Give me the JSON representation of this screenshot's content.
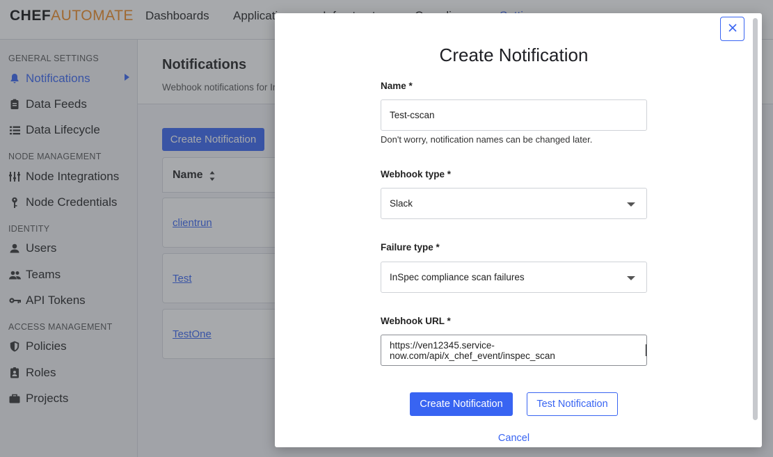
{
  "app": {
    "logo_primary": "CHEF",
    "logo_secondary": "AUTOMATE"
  },
  "topnav": {
    "items": [
      "Dashboards",
      "Applications",
      "Infrastructure",
      "Compliance",
      "Settings"
    ]
  },
  "sidebar": {
    "sections": [
      {
        "title": "GENERAL SETTINGS",
        "items": [
          {
            "label": "Notifications",
            "icon": "bell-icon",
            "active": true
          },
          {
            "label": "Data Feeds",
            "icon": "clipboard-icon"
          },
          {
            "label": "Data Lifecycle",
            "icon": "list-icon"
          }
        ]
      },
      {
        "title": "NODE MANAGEMENT",
        "items": [
          {
            "label": "Node Integrations",
            "icon": "sliders-icon"
          },
          {
            "label": "Node Credentials",
            "icon": "key-icon"
          }
        ]
      },
      {
        "title": "IDENTITY",
        "items": [
          {
            "label": "Users",
            "icon": "user-icon"
          },
          {
            "label": "Teams",
            "icon": "team-icon"
          },
          {
            "label": "API Tokens",
            "icon": "token-key-icon"
          }
        ]
      },
      {
        "title": "ACCESS MANAGEMENT",
        "items": [
          {
            "label": "Policies",
            "icon": "shield-icon"
          },
          {
            "label": "Roles",
            "icon": "badge-icon"
          },
          {
            "label": "Projects",
            "icon": "briefcase-icon"
          }
        ]
      }
    ]
  },
  "page": {
    "title": "Notifications",
    "subtitle": "Webhook notifications for Infrastructure and Compliance",
    "create_button": "Create Notification",
    "table": {
      "header": "Name",
      "rows": [
        "clientrun",
        "Test",
        "TestOne"
      ]
    }
  },
  "modal": {
    "title": "Create Notification",
    "name": {
      "label": "Name *",
      "value": "Test-cscan",
      "hint": "Don't worry, notification names can be changed later."
    },
    "webhook_type": {
      "label": "Webhook type *",
      "value": "Slack"
    },
    "failure_type": {
      "label": "Failure type *",
      "value": "InSpec compliance scan failures"
    },
    "webhook_url": {
      "label": "Webhook URL *",
      "value": "https://ven12345.service-now.com/api/x_chef_event/inspec_scan"
    },
    "create_button": "Create Notification",
    "test_button": "Test Notification",
    "cancel": "Cancel"
  },
  "colors": {
    "accent": "#3864f2",
    "brand_orange": "#f18b21"
  }
}
